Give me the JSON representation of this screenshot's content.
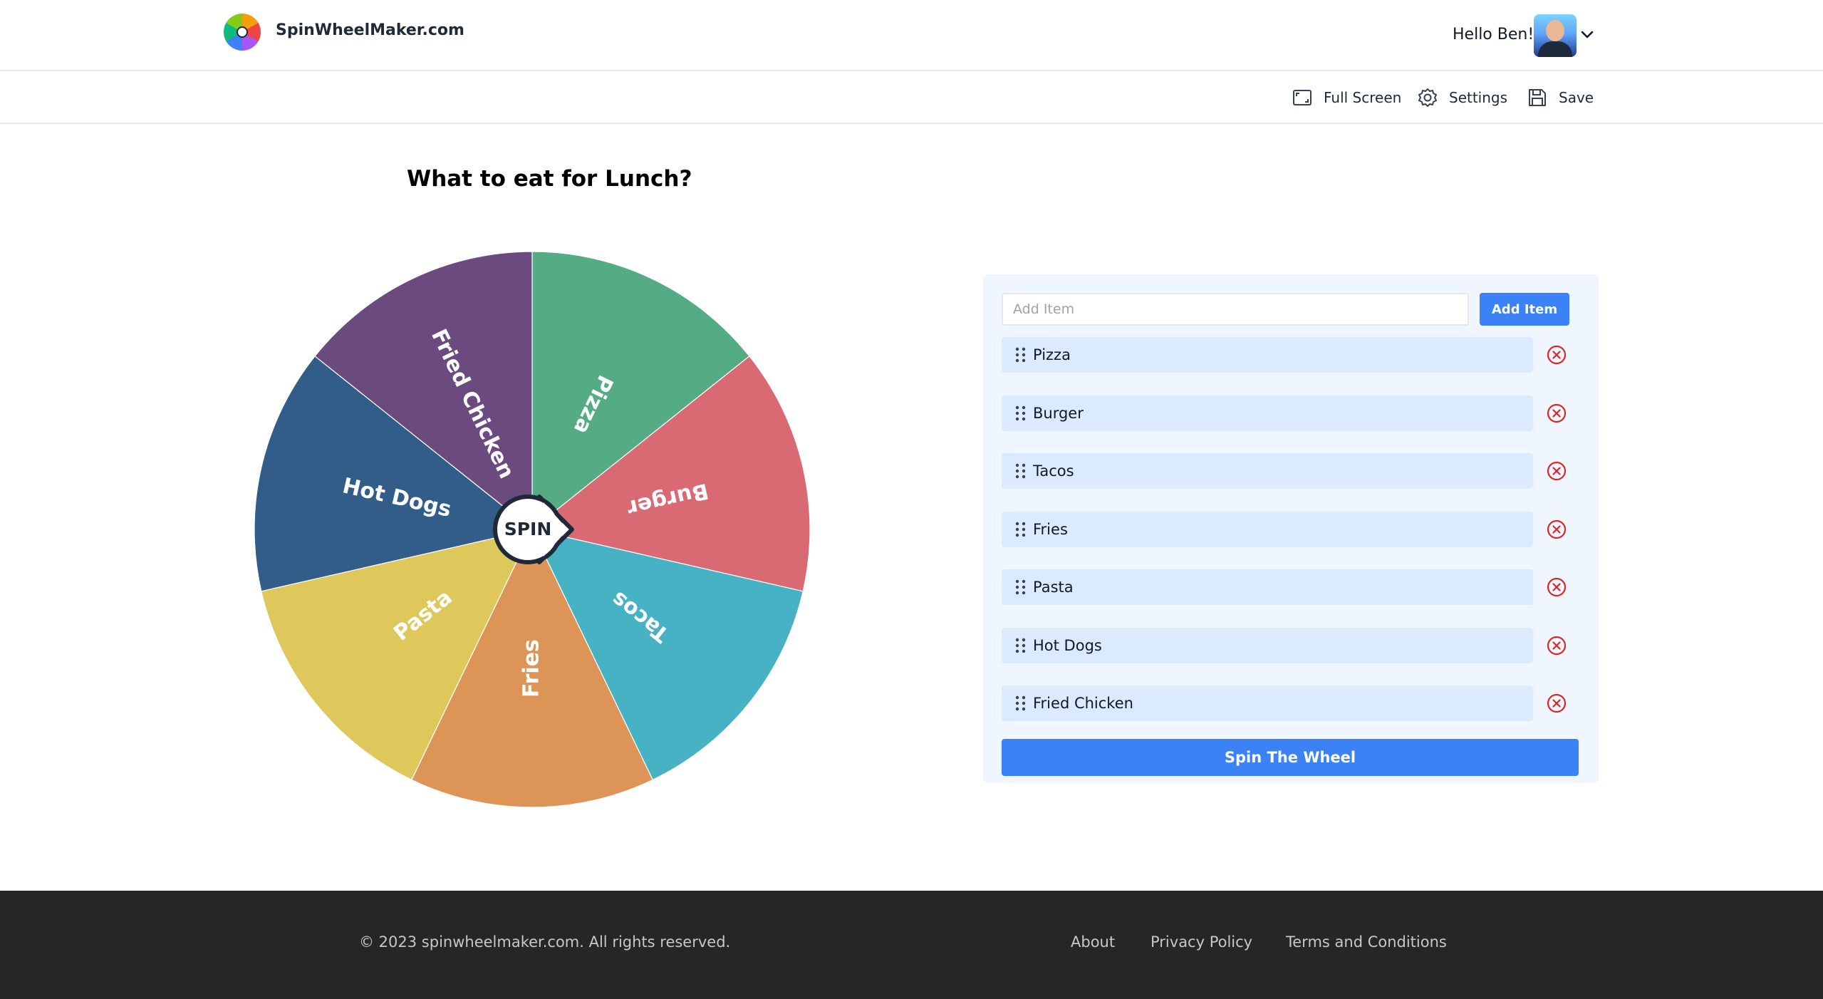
{
  "header": {
    "brand": "SpinWheelMaker.com",
    "greeting": "Hello Ben!"
  },
  "toolbar": {
    "fullscreen_label": "Full Screen",
    "settings_label": "Settings",
    "save_label": "Save"
  },
  "wheel": {
    "title": "What to eat for Lunch?",
    "spin_label": "SPIN",
    "segments": [
      {
        "label": "Pizza",
        "color": "#54ab84"
      },
      {
        "label": "Burger",
        "color": "#d96a74"
      },
      {
        "label": "Tacos",
        "color": "#46b2c3"
      },
      {
        "label": "Fries",
        "color": "#dc9457"
      },
      {
        "label": "Pasta",
        "color": "#dec85c"
      },
      {
        "label": "Hot Dogs",
        "color": "#325d88"
      },
      {
        "label": "Fried Chicken",
        "color": "#6b4a80"
      }
    ]
  },
  "panel": {
    "add_placeholder": "Add Item",
    "add_button": "Add Item",
    "items": [
      "Pizza",
      "Burger",
      "Tacos",
      "Fries",
      "Pasta",
      "Hot Dogs",
      "Fried Chicken"
    ],
    "spin_button": "Spin The Wheel"
  },
  "footer": {
    "copyright": "© 2023 spinwheelmaker.com. All rights reserved.",
    "about": "About",
    "privacy": "Privacy Policy",
    "terms": "Terms and Conditions"
  },
  "colors": {
    "accent": "#3b82f6",
    "panel_bg": "#eff6ff",
    "item_bg": "#dbeafe",
    "remove_icon": "#dc2626",
    "footer_bg": "#262626"
  }
}
